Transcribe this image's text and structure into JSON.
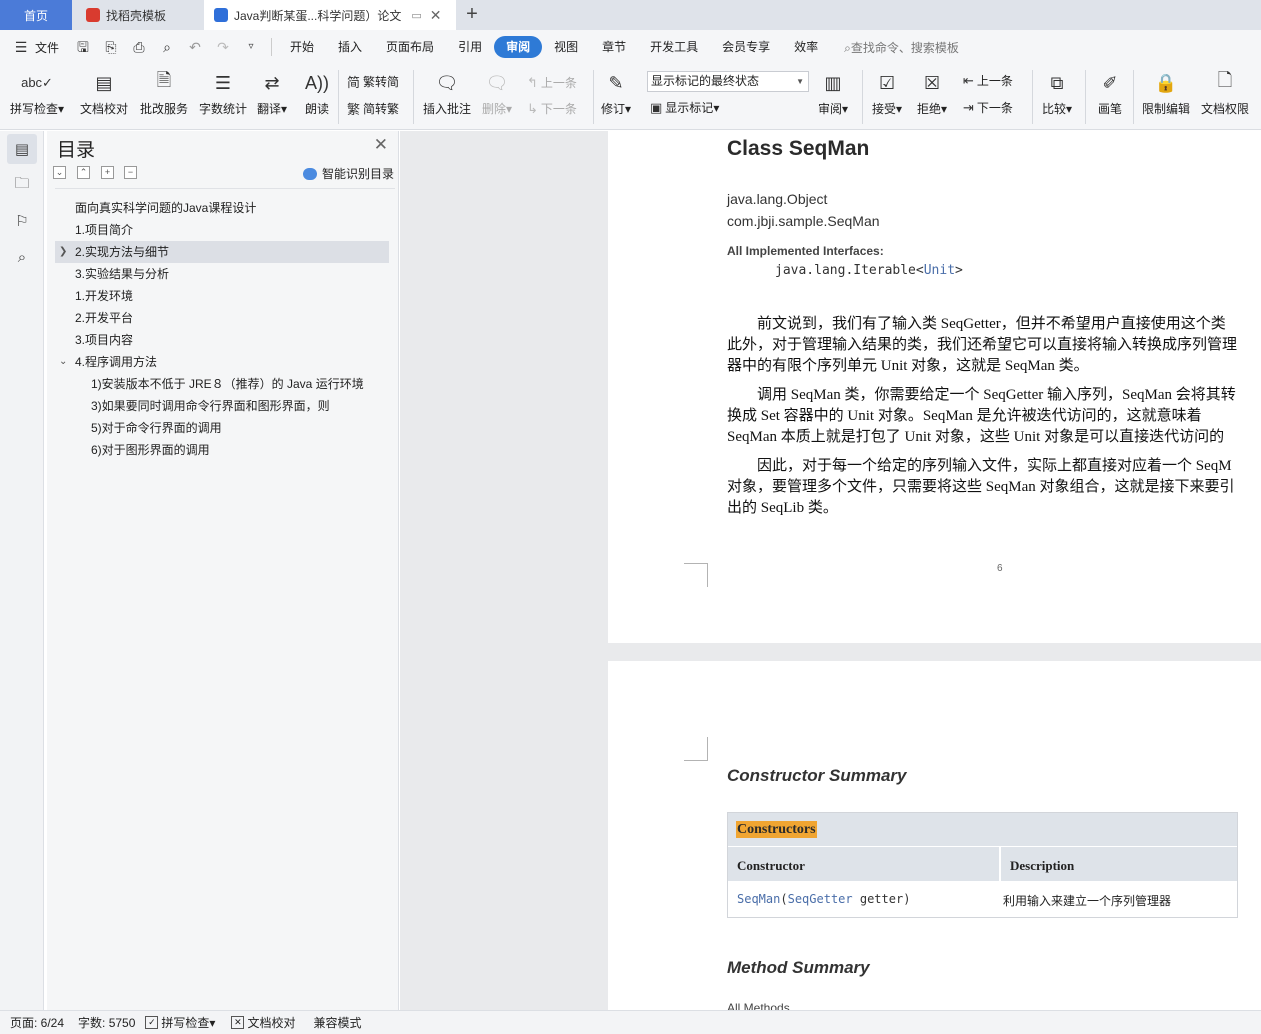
{
  "tabs": {
    "home": "首页",
    "templates": "找稻壳模板",
    "document": "Java判断某蛋...科学问题）论文"
  },
  "menu": {
    "file": "文件",
    "items": [
      "开始",
      "插入",
      "页面布局",
      "引用",
      "审阅",
      "视图",
      "章节",
      "开发工具",
      "会员专享",
      "效率"
    ],
    "active": "审阅",
    "search": "查找命令、搜索模板"
  },
  "ribbon": {
    "spell_check": "拼写检查",
    "doc_proof": "文档校对",
    "revise_service": "批改服务",
    "word_count": "字数统计",
    "translate": "翻译",
    "read_aloud": "朗读",
    "trad_to_simp": "繁转简",
    "simp_to_trad": "简转繁",
    "insert_comment": "插入批注",
    "delete": "删除",
    "prev_item": "上一条",
    "next_item": "下一条",
    "track_changes": "修订",
    "markup_state": "显示标记的最终状态",
    "show_markup": "显示标记",
    "review": "审阅",
    "accept": "接受",
    "reject": "拒绝",
    "prev_change": "上一条",
    "next_change": "下一条",
    "compare": "比较",
    "pen": "画笔",
    "restrict_edit": "限制编辑",
    "doc_permission": "文档权限"
  },
  "toc": {
    "title": "目录",
    "smart": "智能识别目录",
    "items": [
      "面向真实科学问题的Java课程设计",
      "1.项目简介",
      "2.实现方法与细节",
      "3.实验结果与分析",
      "1.开发环境",
      "2.开发平台",
      "3.项目内容",
      "4.程序调用方法",
      "1)安装版本不低于 JRE８（推荐）的 Java 运行环境",
      "3)如果要同时调用命令行界面和图形界面，则",
      "5)对于命令行界面的调用",
      "6)对于图形界面的调用"
    ]
  },
  "doc": {
    "class_title": "Class SeqMan",
    "pkg1": "java.lang.Object",
    "pkg2": "com.jbji.sample.SeqMan",
    "impl_label": "All Implemented Interfaces:",
    "impl_code_pre": "java.lang.Iterable<",
    "impl_code_link": "Unit",
    "impl_code_post": ">",
    "p1_l1": "　　前文说到，我们有了输入类 SeqGetter，但并不希望用户直接使用这个类",
    "p1_l2": "此外，对于管理输入结果的类，我们还希望它可以直接将输入转换成序列管理",
    "p1_l3": "器中的有限个序列单元 Unit 对象，这就是 SeqMan 类。",
    "p2_l1": "　　调用 SeqMan 类，你需要给定一个 SeqGetter 输入序列，SeqMan 会将其转",
    "p2_l2": "换成 Set 容器中的 Unit 对象。SeqMan 是允许被迭代访问的，这就意味着",
    "p2_l3": "SeqMan 本质上就是打包了 Unit 对象，这些 Unit 对象是可以直接迭代访问的",
    "p3_l1": "　　因此，对于每一个给定的序列输入文件，实际上都直接对应着一个 SeqM",
    "p3_l2": "对象，要管理多个文件，只需要将这些 SeqMan 对象组合，这就是接下来要引",
    "p3_l3": "出的 SeqLib 类。",
    "page_number": "6",
    "constructor_summary": "Constructor Summary",
    "constructors_caption": "Constructors",
    "col_constructor": "Constructor",
    "col_description": "Description",
    "ctor_link1": "SeqMan",
    "ctor_mid": "(",
    "ctor_link2": "SeqGetter",
    "ctor_end": " getter)",
    "ctor_desc": "利用输入来建立一个序列管理器",
    "method_summary": "Method Summary",
    "all_methods": "All Methods"
  },
  "status": {
    "page": "页面: 6/24",
    "words": "字数: 5750",
    "spell": "拼写检查",
    "proof": "文档校对",
    "compat": "兼容模式"
  },
  "colors": {
    "accent": "#2e7ad6",
    "home_tab": "#4b7bd8",
    "highlight": "#f0a532"
  }
}
